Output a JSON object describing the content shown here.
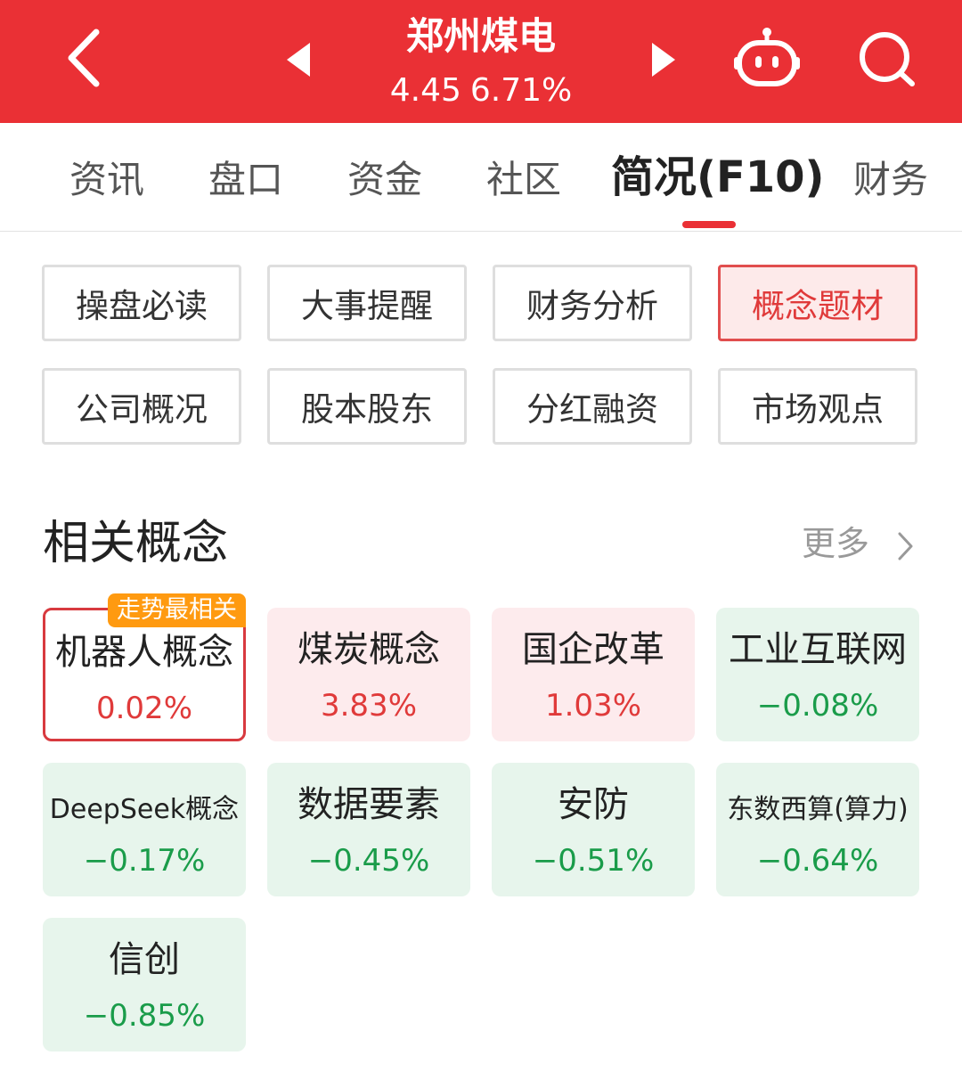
{
  "header": {
    "title": "郑州煤电",
    "price": "4.45",
    "change_pct": "6.71%",
    "icons": [
      "back-arrow-icon",
      "prev-triangle-icon",
      "next-triangle-icon",
      "robot-icon",
      "search-icon"
    ]
  },
  "tabs": [
    {
      "label": "资讯",
      "active": false
    },
    {
      "label": "盘口",
      "active": false
    },
    {
      "label": "资金",
      "active": false
    },
    {
      "label": "社区",
      "active": false
    },
    {
      "label": "简况(F10)",
      "active": true
    },
    {
      "label": "财务",
      "active": false
    }
  ],
  "sub_tabs": [
    {
      "label": "操盘必读",
      "selected": false
    },
    {
      "label": "大事提醒",
      "selected": false
    },
    {
      "label": "财务分析",
      "selected": false
    },
    {
      "label": "概念题材",
      "selected": true
    },
    {
      "label": "公司概况",
      "selected": false
    },
    {
      "label": "股本股东",
      "selected": false
    },
    {
      "label": "分红融资",
      "selected": false
    },
    {
      "label": "市场观点",
      "selected": false
    }
  ],
  "section": {
    "title": "相关概念",
    "more_label": "更多"
  },
  "concepts": [
    {
      "name": "机器人概念",
      "change": "0.02%",
      "trend": "up",
      "badge": "走势最相关"
    },
    {
      "name": "煤炭概念",
      "change": "3.83%",
      "trend": "up"
    },
    {
      "name": "国企改革",
      "change": "1.03%",
      "trend": "up"
    },
    {
      "name": "工业互联网",
      "change": "−0.08%",
      "trend": "down"
    },
    {
      "name": "DeepSeek概念",
      "change": "−0.17%",
      "trend": "down"
    },
    {
      "name": "数据要素",
      "change": "−0.45%",
      "trend": "down"
    },
    {
      "name": "安防",
      "change": "−0.51%",
      "trend": "down"
    },
    {
      "name": "东数西算(算力)",
      "change": "−0.64%",
      "trend": "down"
    },
    {
      "name": "信创",
      "change": "−0.85%",
      "trend": "down"
    }
  ],
  "colors": {
    "brand_red": "#ea3035",
    "up_red": "#e03a3a",
    "down_green": "#1a9c4a",
    "badge_orange": "#ff9a10"
  }
}
